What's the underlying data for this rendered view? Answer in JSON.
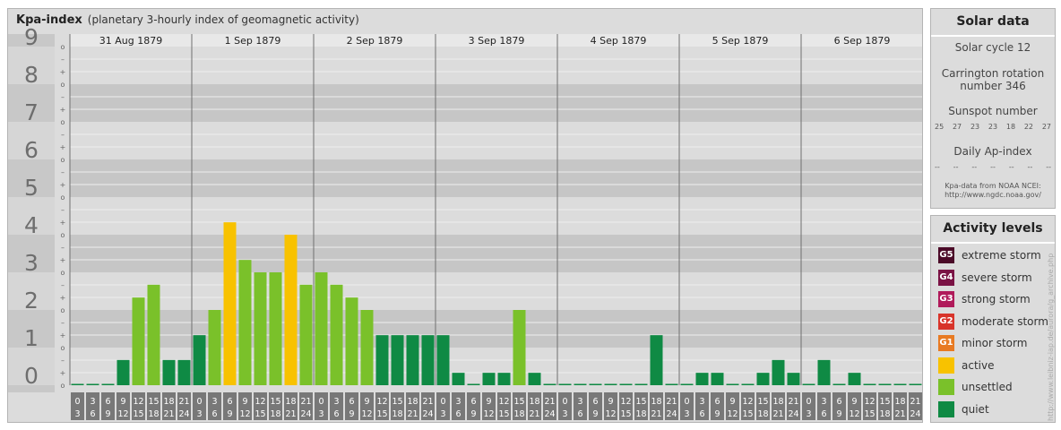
{
  "header": {
    "title": "Kpa-index",
    "subtitle": "(planetary 3-hourly index of geomagnetic activity)"
  },
  "chart_data": {
    "type": "bar",
    "title": "Kpa-index",
    "subtitle": "(planetary 3-hourly index of geomagnetic activity)",
    "ylim": [
      0,
      9
    ],
    "y_ticks": [
      "0",
      "1",
      "2",
      "3",
      "4",
      "5",
      "6",
      "7",
      "8",
      "9"
    ],
    "sub_ticks": [
      "–",
      "+",
      "o"
    ],
    "days": [
      "31 Aug 1879",
      "1 Sep 1879",
      "2 Sep 1879",
      "3 Sep 1879",
      "4 Sep 1879",
      "5 Sep 1879",
      "6 Sep 1879"
    ],
    "interval_top": [
      "0",
      "3",
      "6",
      "9",
      "12",
      "15",
      "18",
      "21"
    ],
    "interval_bottom": [
      "3",
      "6",
      "9",
      "12",
      "15",
      "18",
      "21",
      "24"
    ],
    "values": [
      [
        0,
        0,
        0,
        0.67,
        2.33,
        2.67,
        0.67,
        0.67
      ],
      [
        1.33,
        2,
        4.33,
        3.33,
        3,
        3,
        4,
        2.67
      ],
      [
        3,
        2.67,
        2.33,
        2,
        1.33,
        1.33,
        1.33,
        1.33
      ],
      [
        1.33,
        0.33,
        0,
        0.33,
        0.33,
        2,
        0.33,
        0
      ],
      [
        0,
        0,
        0,
        0,
        0,
        0,
        1.33,
        0
      ],
      [
        0,
        0.33,
        0.33,
        0,
        0,
        0.33,
        0.67,
        0.33
      ],
      [
        0,
        0.67,
        0,
        0.33,
        0,
        0,
        0,
        0
      ]
    ],
    "levels": [
      {
        "code": "G5",
        "name": "extreme storm",
        "color": "#4b0a28"
      },
      {
        "code": "G4",
        "name": "severe storm",
        "color": "#7a1244"
      },
      {
        "code": "G3",
        "name": "strong storm",
        "color": "#b01a5a"
      },
      {
        "code": "G2",
        "name": "moderate storm",
        "color": "#d8342a"
      },
      {
        "code": "G1",
        "name": "minor storm",
        "color": "#e87a22"
      },
      {
        "code": "",
        "name": "active",
        "color": "#f8c200"
      },
      {
        "code": "",
        "name": "unsettled",
        "color": "#7ac12a"
      },
      {
        "code": "",
        "name": "quiet",
        "color": "#0f8a44"
      }
    ],
    "grid": true,
    "legend": "right"
  },
  "solar": {
    "title": "Solar data",
    "cycle": "Solar cycle 12",
    "rotation_line1": "Carrington rotation",
    "rotation_line2": "number 346",
    "sunspot_title": "Sunspot number",
    "sunspots": [
      "25",
      "27",
      "23",
      "23",
      "18",
      "22",
      "27"
    ],
    "ap_title": "Daily Ap-index",
    "ap_values": [
      "--",
      "--",
      "--",
      "--",
      "--",
      "--",
      "--"
    ],
    "source_line1": "Kpa-data from NOAA NCEI:",
    "source_line2": "http://www.ngdc.noaa.gov/"
  },
  "activity": {
    "title": "Activity levels"
  },
  "credit": "http://www.leibniz-iap.de/aurora/g_archive.php"
}
